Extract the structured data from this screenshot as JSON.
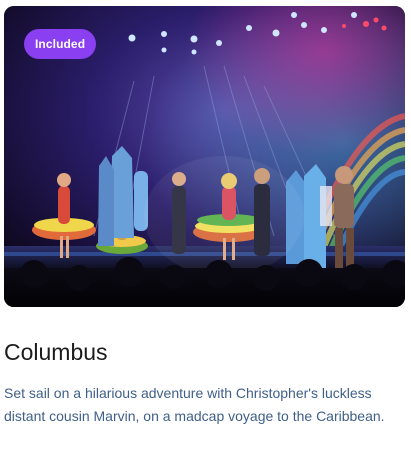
{
  "card": {
    "badge_label": "Included",
    "title": "Columbus",
    "description": "Set sail on a hilarious adventure with Christopher's luckless distant cousin Marvin, on a madcap voyage to the Caribbean.",
    "image_alt": "Stage show performers in colorful costumes",
    "badge_color": "#8a3ff0",
    "title_color": "#1b1b1b",
    "description_color": "#3f5f8a"
  }
}
